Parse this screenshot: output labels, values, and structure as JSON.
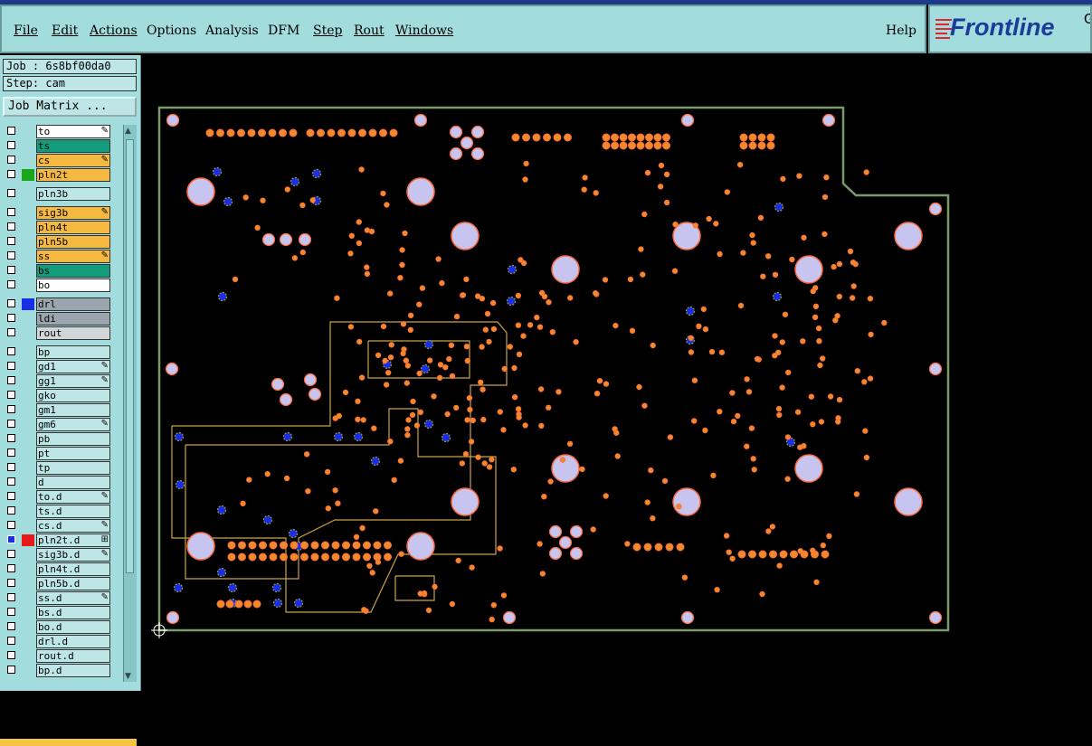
{
  "menubar": {
    "items": [
      "File",
      "Edit",
      "Actions",
      "Options",
      "Analysis",
      "DFM",
      "Step",
      "Rout",
      "Windows"
    ],
    "help": "Help"
  },
  "logo": {
    "text": "Frontline",
    "partial": "G"
  },
  "job": {
    "job_line": "Job : 6s8bf00da0",
    "step_line": "Step: cam",
    "matrix_button": "Job Matrix ..."
  },
  "layers": [
    {
      "name": "to",
      "color": "#ffffff",
      "swatch": "",
      "mark": "✎"
    },
    {
      "name": "ts",
      "color": "#129c7c",
      "swatch": "",
      "mark": ""
    },
    {
      "name": "cs",
      "color": "#f5b942",
      "swatch": "",
      "mark": "✎"
    },
    {
      "name": "pln2t",
      "color": "#f5b942",
      "swatch": "#1aa61a",
      "mark": ""
    },
    {
      "name": "pln3b",
      "color": "#bfe6e6",
      "swatch": "",
      "mark": ""
    },
    {
      "name": "sig3b",
      "color": "#f5b942",
      "swatch": "",
      "mark": "✎"
    },
    {
      "name": "pln4t",
      "color": "#f5b942",
      "swatch": "",
      "mark": ""
    },
    {
      "name": "pln5b",
      "color": "#f5b942",
      "swatch": "",
      "mark": ""
    },
    {
      "name": "ss",
      "color": "#f5b942",
      "swatch": "",
      "mark": "✎"
    },
    {
      "name": "bs",
      "color": "#129c7c",
      "swatch": "",
      "mark": ""
    },
    {
      "name": "bo",
      "color": "#ffffff",
      "swatch": "",
      "mark": ""
    },
    {
      "name": "drl",
      "color": "#9aa5ad",
      "swatch": "#1a2ee6",
      "mark": ""
    },
    {
      "name": "ldi",
      "color": "#9aa5ad",
      "swatch": "",
      "mark": ""
    },
    {
      "name": "rout",
      "color": "#d2d6d8",
      "swatch": "",
      "mark": ""
    },
    {
      "name": "bp",
      "color": "#bfe6e6",
      "swatch": "",
      "mark": ""
    },
    {
      "name": "gd1",
      "color": "#bfe6e6",
      "swatch": "",
      "mark": "✎"
    },
    {
      "name": "gg1",
      "color": "#bfe6e6",
      "swatch": "",
      "mark": "✎"
    },
    {
      "name": "gko",
      "color": "#bfe6e6",
      "swatch": "",
      "mark": ""
    },
    {
      "name": "gm1",
      "color": "#bfe6e6",
      "swatch": "",
      "mark": ""
    },
    {
      "name": "gm6",
      "color": "#bfe6e6",
      "swatch": "",
      "mark": "✎"
    },
    {
      "name": "pb",
      "color": "#bfe6e6",
      "swatch": "",
      "mark": ""
    },
    {
      "name": "pt",
      "color": "#bfe6e6",
      "swatch": "",
      "mark": ""
    },
    {
      "name": "tp",
      "color": "#bfe6e6",
      "swatch": "",
      "mark": ""
    },
    {
      "name": "d",
      "color": "#bfe6e6",
      "swatch": "",
      "mark": ""
    },
    {
      "name": "to.d",
      "color": "#bfe6e6",
      "swatch": "",
      "mark": "✎"
    },
    {
      "name": "ts.d",
      "color": "#bfe6e6",
      "swatch": "",
      "mark": ""
    },
    {
      "name": "cs.d",
      "color": "#bfe6e6",
      "swatch": "",
      "mark": "✎"
    },
    {
      "name": "pln2t.d",
      "color": "#bfe6e6",
      "swatch": "#e61a1a",
      "mark": "⊞",
      "selected": true
    },
    {
      "name": "sig3b.d",
      "color": "#bfe6e6",
      "swatch": "",
      "mark": "✎"
    },
    {
      "name": "pln4t.d",
      "color": "#bfe6e6",
      "swatch": "",
      "mark": ""
    },
    {
      "name": "pln5b.d",
      "color": "#bfe6e6",
      "swatch": "",
      "mark": ""
    },
    {
      "name": "ss.d",
      "color": "#bfe6e6",
      "swatch": "",
      "mark": "✎"
    },
    {
      "name": "bs.d",
      "color": "#bfe6e6",
      "swatch": "",
      "mark": ""
    },
    {
      "name": "bo.d",
      "color": "#bfe6e6",
      "swatch": "",
      "mark": ""
    },
    {
      "name": "drl.d",
      "color": "#bfe6e6",
      "swatch": "",
      "mark": ""
    },
    {
      "name": "rout.d",
      "color": "#bfe6e6",
      "swatch": "",
      "mark": ""
    },
    {
      "name": "bp.d",
      "color": "#bfe6e6",
      "swatch": "",
      "mark": ""
    }
  ],
  "colors": {
    "pad": "#f08a2a",
    "pad_core": "#ff6a3a",
    "hole": "#c8c4f0",
    "outline": "#7a9a6a",
    "rout": "#c9a24a",
    "via": "#1a2ee6"
  }
}
